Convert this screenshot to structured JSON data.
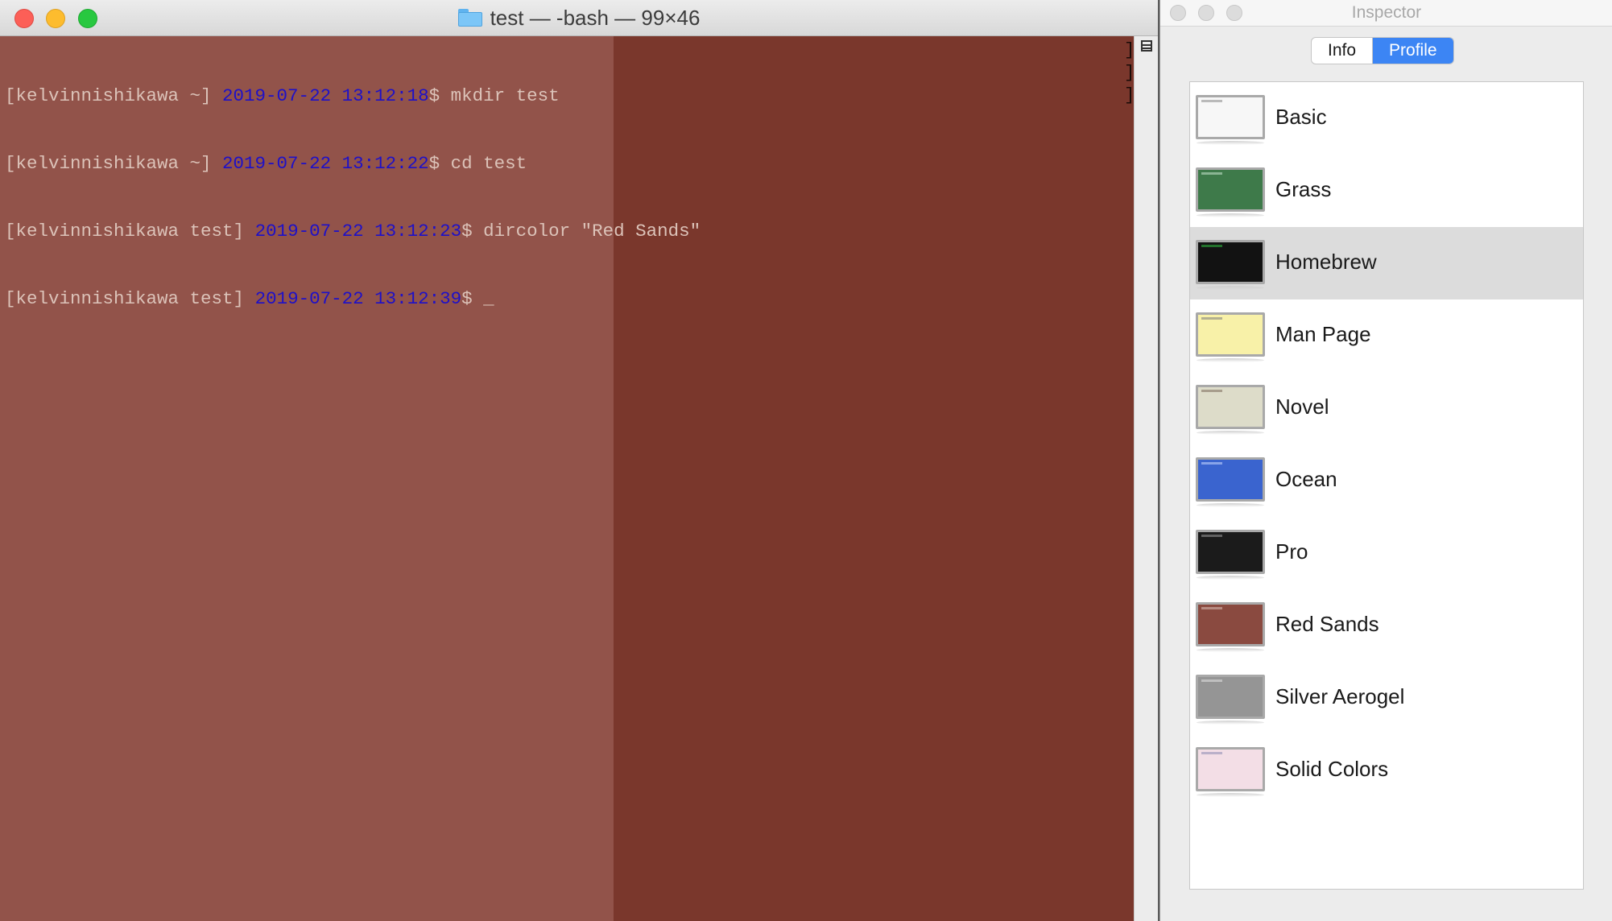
{
  "terminal": {
    "window_title": "test — -bash — 99×46",
    "lines": [
      {
        "prompt": "[kelvinnishikawa ~] ",
        "timestamp": "2019-07-22 13:12:18",
        "command": "$ mkdir test"
      },
      {
        "prompt": "[kelvinnishikawa ~] ",
        "timestamp": "2019-07-22 13:12:22",
        "command": "$ cd test"
      },
      {
        "prompt": "[kelvinnishikawa test] ",
        "timestamp": "2019-07-22 13:12:23",
        "command": "$ dircolor \"Red Sands\""
      },
      {
        "prompt": "[kelvinnishikawa test] ",
        "timestamp": "2019-07-22 13:12:39",
        "command": "$ "
      }
    ],
    "cursor": "_",
    "right_bracket": "]"
  },
  "inspector": {
    "title": "Inspector",
    "tabs": [
      "Info",
      "Profile"
    ],
    "active_tab": "Profile",
    "selected_profile": "Homebrew",
    "profiles": [
      {
        "name": "Basic",
        "bg": "#f7f7f7",
        "fg": "#888888"
      },
      {
        "name": "Grass",
        "bg": "#3e7a4a",
        "fg": "#c9e6cf"
      },
      {
        "name": "Homebrew",
        "bg": "#121212",
        "fg": "#2fbd3f"
      },
      {
        "name": "Man Page",
        "bg": "#f8f1a8",
        "fg": "#7a7a7a"
      },
      {
        "name": "Novel",
        "bg": "#dddcc9",
        "fg": "#7a6a5a"
      },
      {
        "name": "Ocean",
        "bg": "#3a64cf",
        "fg": "#c9d8ff"
      },
      {
        "name": "Pro",
        "bg": "#1b1b1b",
        "fg": "#9a9a9a"
      },
      {
        "name": "Red Sands",
        "bg": "#8a4a40",
        "fg": "#dcc3b9"
      },
      {
        "name": "Silver Aerogel",
        "bg": "#959595",
        "fg": "#e2e2e2"
      },
      {
        "name": "Solid Colors",
        "bg": "#f3dee6",
        "fg": "#8a8ab0"
      }
    ]
  },
  "colors": {
    "terminal_bg": "#7a372c",
    "terminal_text": "#dcc3b9",
    "timestamp": "#1e10c8",
    "accent": "#3c85f4"
  }
}
